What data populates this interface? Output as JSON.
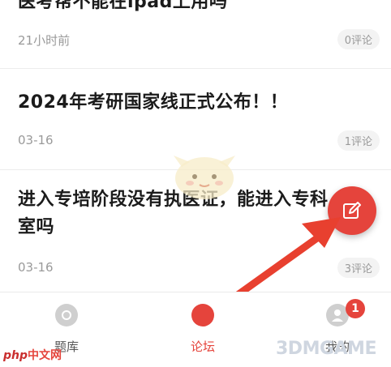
{
  "posts": [
    {
      "title": "医考帮不能在ipad上用吗",
      "date": "21小时前",
      "comments": "0评论"
    },
    {
      "title": "2024年考研国家线正式公布！！",
      "date": "03-16",
      "comments": "1评论"
    },
    {
      "title": "进入专培阶段没有执医证，能进入专科室吗",
      "date": "03-16",
      "comments": "3评论"
    }
  ],
  "tabs": [
    {
      "label": "题库",
      "icon": "question-bank-icon"
    },
    {
      "label": "论坛",
      "icon": "forum-icon"
    },
    {
      "label": "我的",
      "icon": "profile-icon",
      "badge": "1"
    }
  ],
  "watermark": {
    "left_brand": "php",
    "left_text": "中文网",
    "right_text": "3DMGAME"
  },
  "colors": {
    "accent": "#e5443c",
    "muted": "#9a9a9a",
    "title": "#1b1b1b"
  }
}
